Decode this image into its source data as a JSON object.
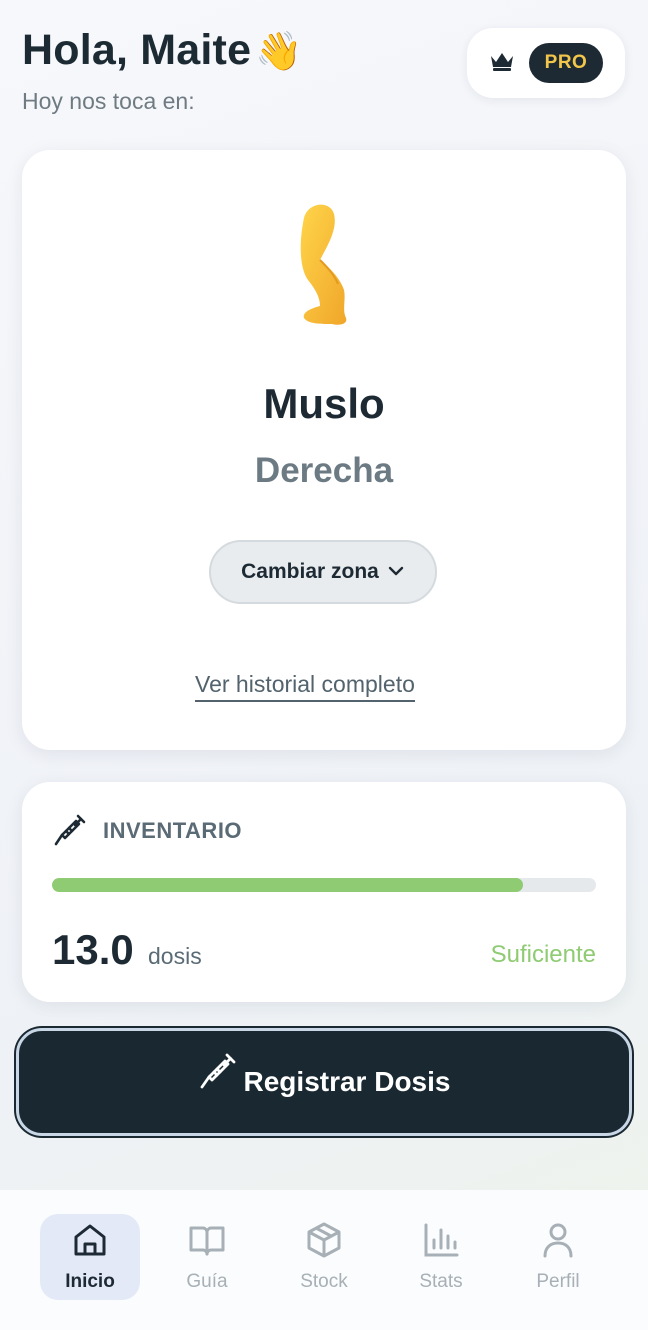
{
  "header": {
    "greeting": "Hola, Maite",
    "wave_emoji": "👋",
    "subtitle": "Hoy nos toca en:",
    "pro_label": "PRO",
    "crown_icon": "crown-icon"
  },
  "zone": {
    "icon": "leg-icon",
    "name": "Muslo",
    "side": "Derecha",
    "change_label": "Cambiar zona",
    "history_link": "Ver historial completo"
  },
  "inventory": {
    "icon": "syringe-icon",
    "title": "INVENTARIO",
    "progress_fraction": 0.865,
    "doses_value": "13.0",
    "doses_unit": "dosis",
    "status": "Suficiente",
    "status_color": "#8ecb72"
  },
  "register": {
    "icon": "syringe-icon",
    "label": "Registrar Dosis"
  },
  "nav": {
    "items": [
      {
        "label": "Inicio",
        "icon": "home-icon",
        "active": true
      },
      {
        "label": "Guía",
        "icon": "book-icon",
        "active": false
      },
      {
        "label": "Stock",
        "icon": "box-icon",
        "active": false
      },
      {
        "label": "Stats",
        "icon": "chart-icon",
        "active": false
      },
      {
        "label": "Perfil",
        "icon": "user-icon",
        "active": false
      }
    ]
  },
  "colors": {
    "accent_dark": "#1a2831",
    "pro_text": "#f2c64a",
    "progress": "#8ecb72",
    "nav_active_bg": "#e3e9f7"
  }
}
